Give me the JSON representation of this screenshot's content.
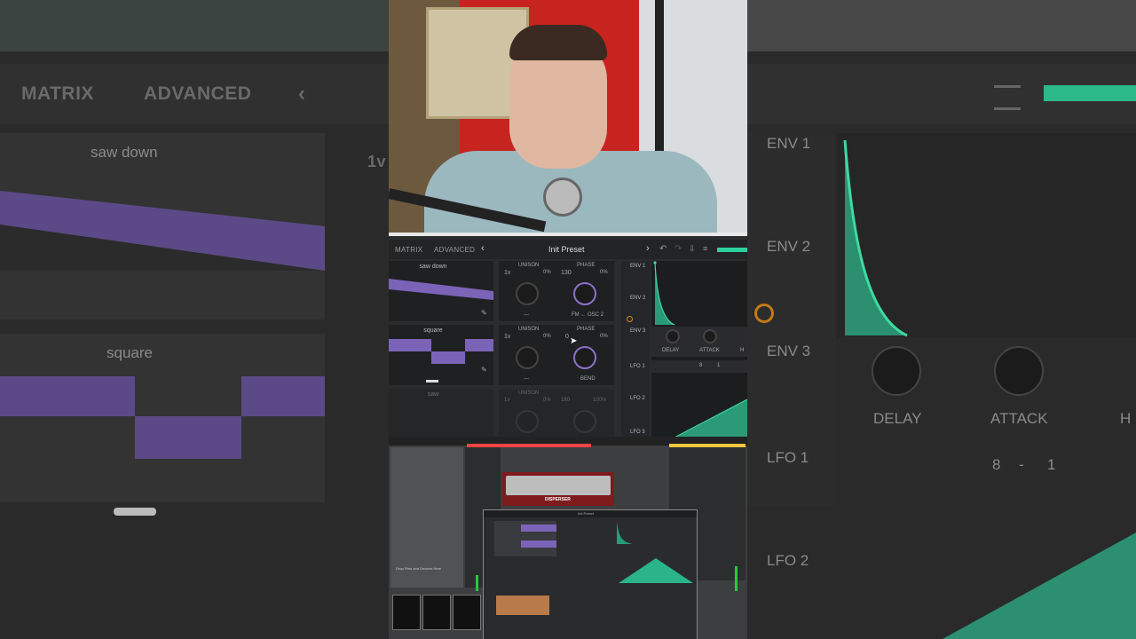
{
  "background": {
    "left_tabs": [
      "MATRIX",
      "ADVANCED"
    ],
    "left_waves": [
      "saw down",
      "square"
    ],
    "left_partial": "1v",
    "right_env_labels": [
      "ENV 1",
      "ENV 2",
      "ENV 3"
    ],
    "right_knob_labels": [
      "DELAY",
      "ATTACK",
      "H"
    ],
    "right_lfo_labels": [
      "LFO 1",
      "LFO 2"
    ],
    "right_lfo_rate": [
      "8",
      "-",
      "1"
    ]
  },
  "synth": {
    "tabs": [
      "MATRIX",
      "ADVANCED"
    ],
    "preset_name": "Init Preset",
    "osc1": {
      "wave": "saw down",
      "unison_label": "UNISON",
      "voices": "1v",
      "unison_pct": "0%",
      "phase_label": "PHASE",
      "phase_value": "130",
      "phase_pct": "0%",
      "left_select": "---",
      "right_select": "FM ← OSC 2"
    },
    "osc2": {
      "wave": "square",
      "unison_label": "UNISON",
      "voices": "1v",
      "unison_pct": "0%",
      "phase_label": "PHASE",
      "phase_value": "0",
      "phase_pct": "0%",
      "left_select": "---",
      "right_select": "BEND"
    },
    "osc3": {
      "wave": "saw",
      "unison_label": "UNISON",
      "voices": "1v",
      "unison_pct": "0%",
      "phase_value": "180",
      "phase_pct": "100%"
    },
    "env_labels": [
      "ENV 1",
      "ENV 2",
      "ENV 3"
    ],
    "env_knobs": [
      "DELAY",
      "ATTACK",
      "H"
    ],
    "lfo_labels": [
      "LFO 1",
      "LFO 2",
      "LFO 3"
    ],
    "lfo_rate": [
      "8",
      "1"
    ]
  },
  "daw": {
    "plugin_name": "DISPERSER",
    "mini_preset": "Init Preset",
    "drop_hint": "Drop Files and Devices Here",
    "colors": {
      "accent": "#2bd19b",
      "purple": "#8a72c9",
      "plugin_red": "#8b1a1c"
    }
  }
}
